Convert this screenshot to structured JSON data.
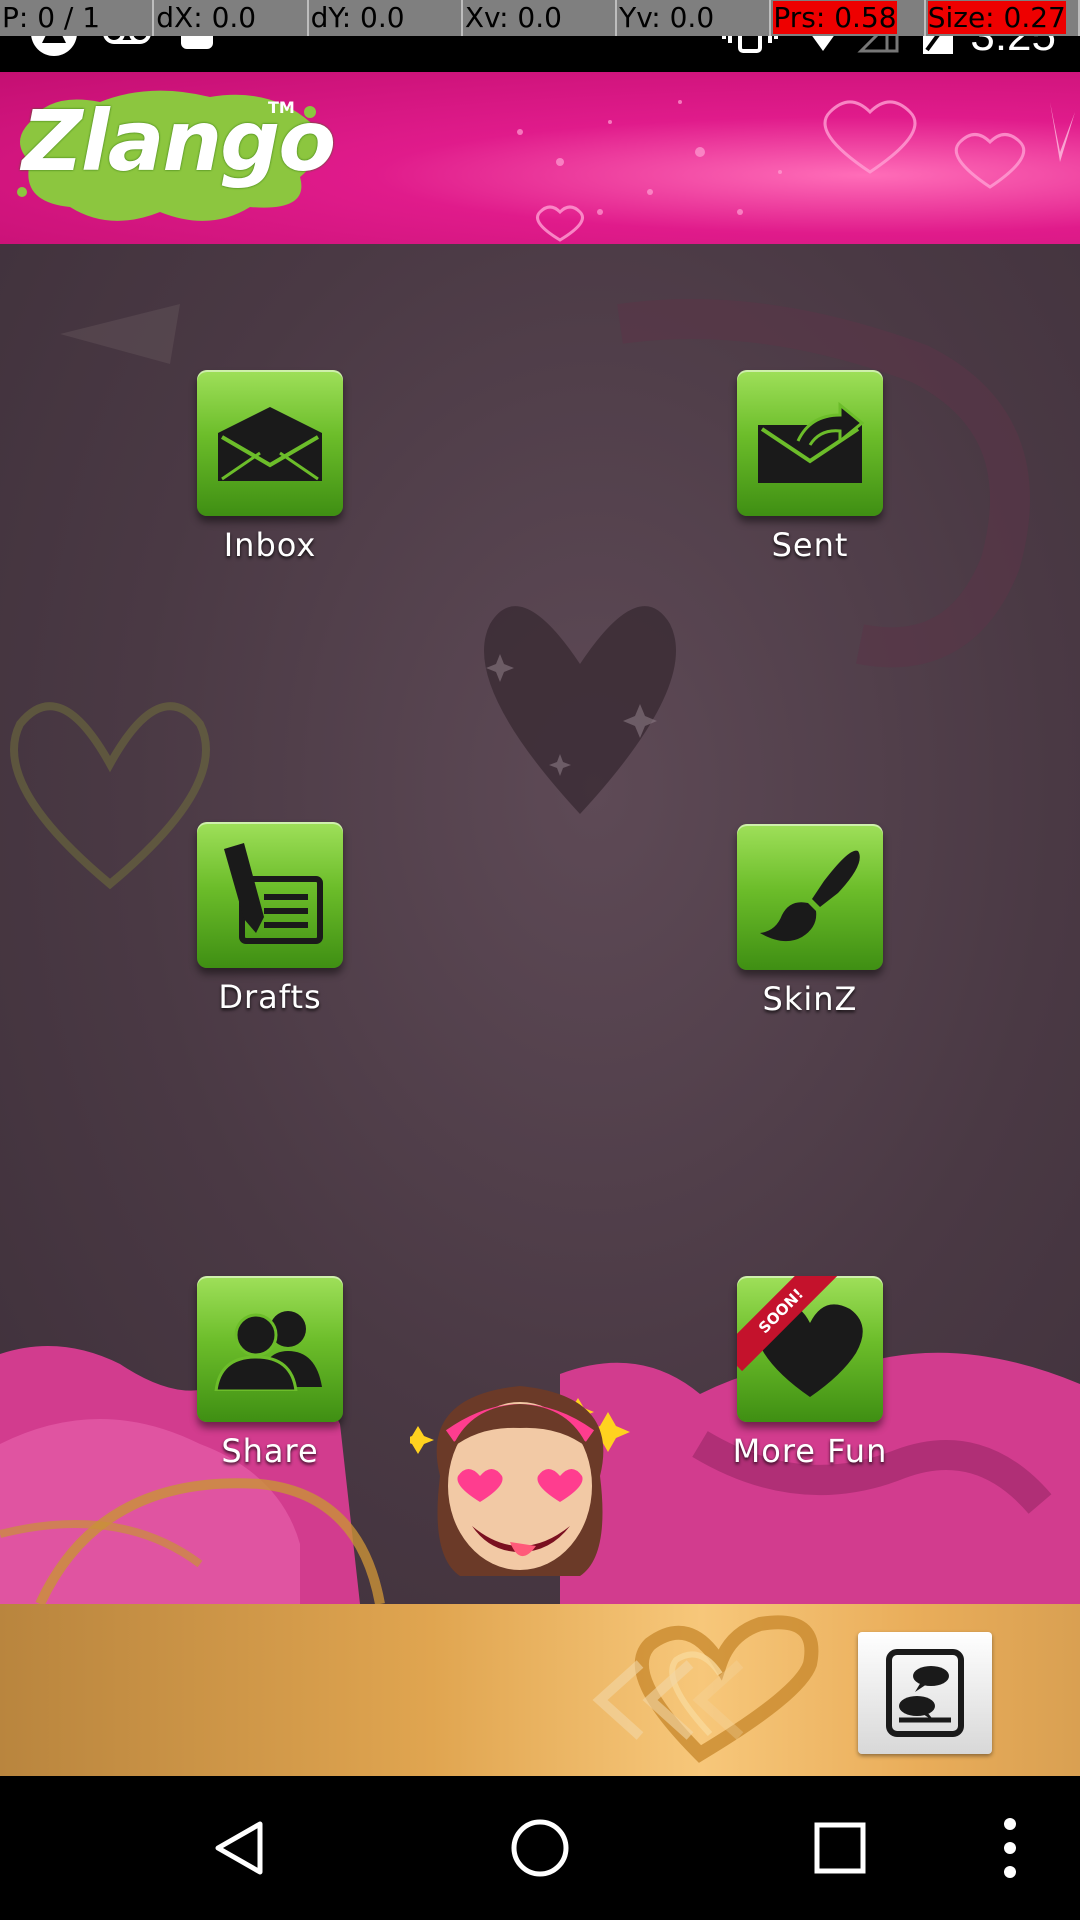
{
  "debug_overlay": {
    "pointer": "P: 0 / 1",
    "dx": "dX: 0.0",
    "dy": "dY: 0.0",
    "xv": "Xv: 0.0",
    "yv": "Yv: 0.0",
    "prs": "Prs: 0.58",
    "size": "Size: 0.27"
  },
  "status_bar": {
    "time": "3:25",
    "icons": [
      "app-notification-icon",
      "voicemail-icon",
      "android-icon",
      "vibrate-icon",
      "wifi-icon",
      "signal-icon",
      "battery-icon"
    ]
  },
  "header": {
    "logo_text": "Zlango",
    "logo_tm": "TM"
  },
  "menu": {
    "inbox": "Inbox",
    "sent": "Sent",
    "drafts": "Drafts",
    "skinz": "SkinZ",
    "share": "Share",
    "more_fun": "More Fun",
    "soon_badge": "SOON!"
  },
  "bottom_bar": {
    "icons": [
      "heart-arrows-icon",
      "chat-bubbles-icon"
    ]
  },
  "nav_bar": {
    "icons": [
      "back-icon",
      "home-icon",
      "recents-icon",
      "overflow-menu-icon"
    ]
  },
  "colors": {
    "header_pink": "#e01b8b",
    "main_bg": "#4a3944",
    "tile_green": "#6cbd2a",
    "gold": "#e0a550"
  }
}
